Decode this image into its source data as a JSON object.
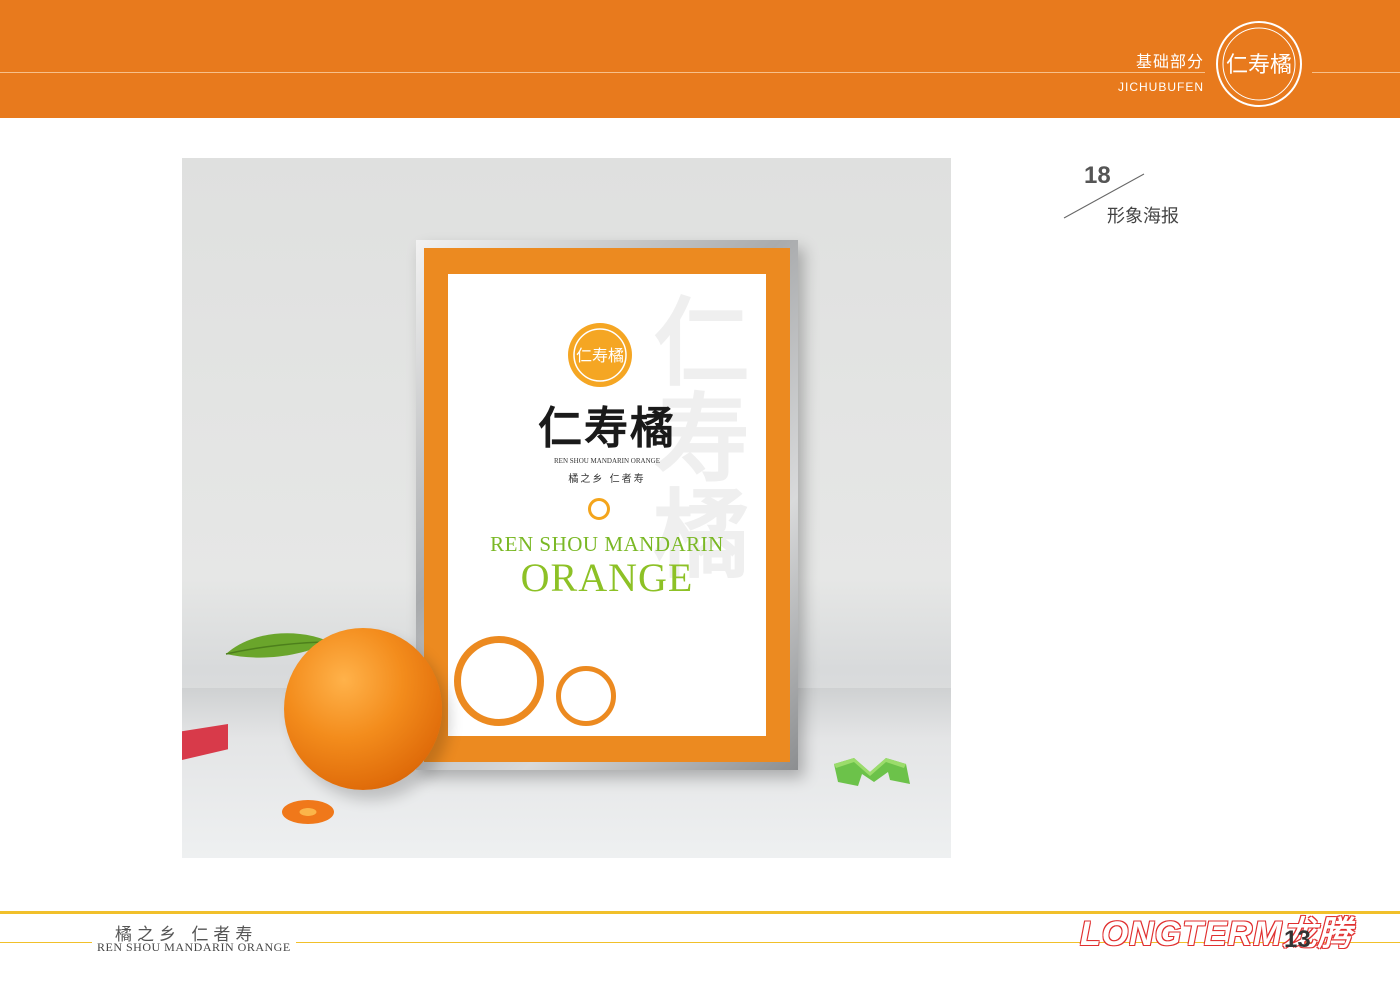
{
  "header": {
    "section_cn": "基础部分",
    "section_en": "JICHUBUFEN",
    "logo_icon": "ren-shou-ju-seal-logo",
    "logo_chars": "仁寿橘",
    "band_color": "#e87a1d"
  },
  "page_label": {
    "number": "18",
    "title": "形象海报"
  },
  "poster": {
    "vertical_watermark": "仁寿橘",
    "logo_chars": "仁寿橘",
    "brand_cn": "仁寿橘",
    "brand_en": "REN SHOU MANDARIN ORANGE",
    "slogan": "橘之乡   仁者寿",
    "headline_en_line1": "REN SHOU MANDARIN",
    "headline_en_line2": "ORANGE",
    "accent_orange": "#ec8a20",
    "accent_green": "#8dc126"
  },
  "footer": {
    "slogan_cn": "橘之乡   仁者寿",
    "slogan_en": "REN SHOU MANDARIN ORANGE",
    "brand": "LONGTERM龙腾",
    "page_number": "13",
    "line_color": "#f1c02a"
  }
}
